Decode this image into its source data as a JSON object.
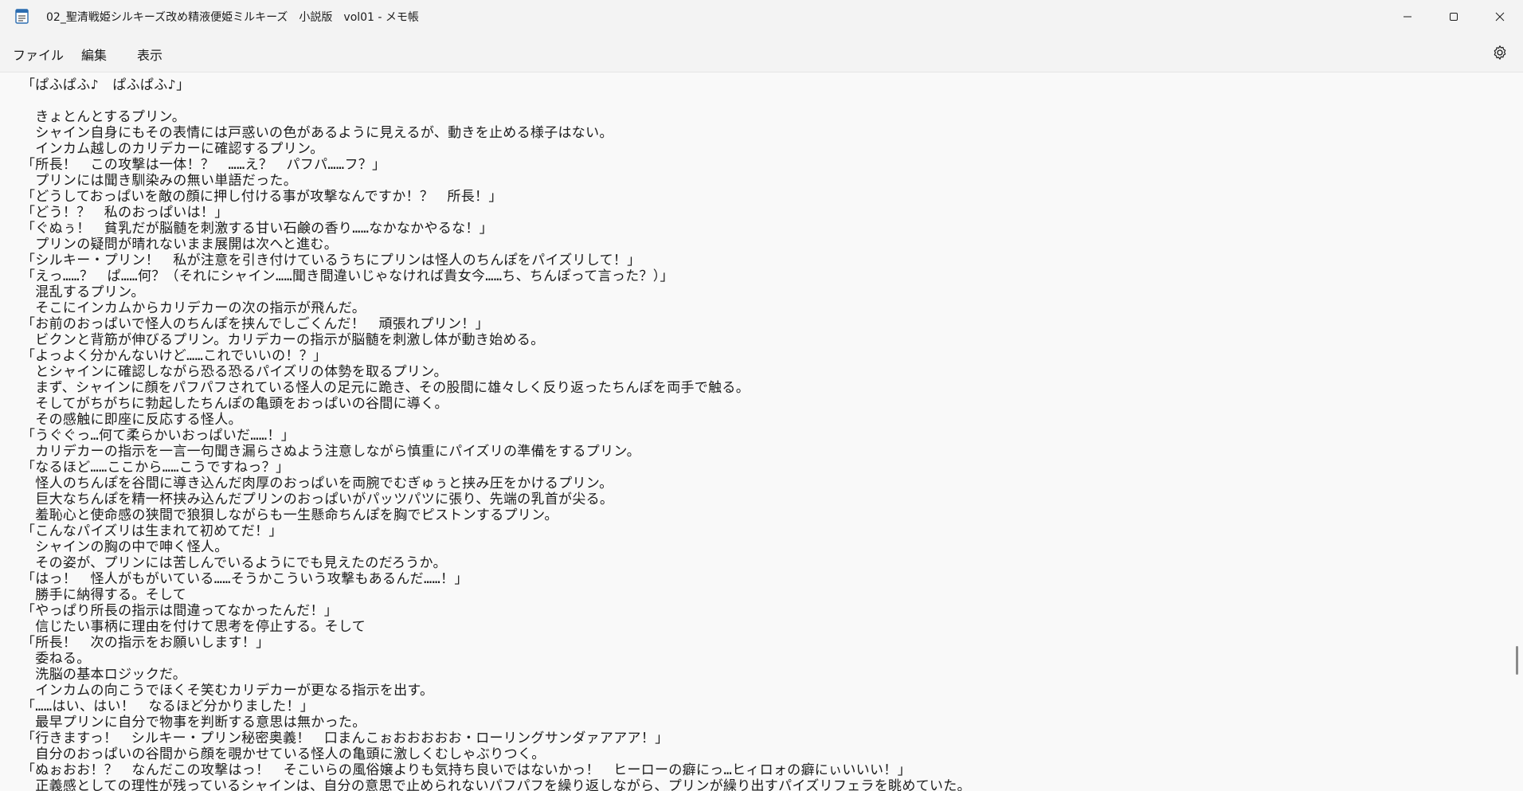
{
  "window": {
    "title": "02_聖清戦姫シルキーズ改め精液便姫ミルキーズ　小説版　vol01 - メモ帳",
    "app_icon": "notepad-icon",
    "controls": [
      "minimize-icon",
      "maximize-icon",
      "close-icon"
    ]
  },
  "menu": {
    "file": "ファイル",
    "edit": "編集",
    "view": "表示",
    "settings_icon": "gear-icon"
  },
  "editor": {
    "lines": [
      "「ぱふぱふ♪　ぱふぱふ♪」",
      "",
      "　きょとんとするプリン。",
      "　シャイン自身にもその表情には戸惑いの色があるように見えるが、動きを止める様子はない。",
      "　インカム越しのカリデカーに確認するプリン。",
      "「所長！　この攻撃は一体！？　……え？　パフパ……フ？」",
      "　プリンには聞き馴染みの無い単語だった。",
      "「どうしておっぱいを敵の顔に押し付ける事が攻撃なんですか！？　所長！」",
      "「どう！？　私のおっぱいは！」",
      "「ぐぬぅ！　貧乳だが脳髄を刺激する甘い石鹸の香り……なかなかやるな！」",
      "　プリンの疑問が晴れないまま展開は次へと進む。",
      "「シルキー・プリン！　私が注意を引き付けているうちにプリンは怪人のちんぽをパイズリして！」",
      "「えっ……？　ぱ……何？（それにシャイン……聞き間違いじゃなければ貴女今……ち、ちんぽって言った？）」",
      "　混乱するプリン。",
      "　そこにインカムからカリデカーの次の指示が飛んだ。",
      "「お前のおっぱいで怪人のちんぽを挟んでしごくんだ！　頑張れプリン！」",
      "　ビクンと背筋が伸びるプリン。カリデカーの指示が脳髄を刺激し体が動き始める。",
      "「よっよく分かんないけど……これでいいの！？」",
      "　とシャインに確認しながら恐る恐るパイズリの体勢を取るプリン。",
      "　まず、シャインに顔をパフパフされている怪人の足元に跪き、その股間に雄々しく反り返ったちんぽを両手で触る。",
      "　そしてがちがちに勃起したちんぽの亀頭をおっぱいの谷間に導く。",
      "　その感触に即座に反応する怪人。",
      "「うぐぐっ…何て柔らかいおっぱいだ……！」",
      "　カリデカーの指示を一言一句聞き漏らさぬよう注意しながら慎重にパイズリの準備をするプリン。",
      "「なるほど……ここから……こうですねっ？」",
      "　怪人のちんぽを谷間に導き込んだ肉厚のおっぱいを両腕でむぎゅぅと挟み圧をかけるプリン。",
      "　巨大なちんぽを精一杯挟み込んだプリンのおっぱいがパッツパツに張り、先端の乳首が尖る。",
      "　羞恥心と使命感の狭間で狼狽しながらも一生懸命ちんぽを胸でピストンするプリン。",
      "「こんなパイズリは生まれて初めてだ！」",
      "　シャインの胸の中で呻く怪人。",
      "　その姿が、プリンには苦しんでいるようにでも見えたのだろうか。",
      "「はっ！　怪人がもがいている……そうかこういう攻撃もあるんだ……！」",
      "　勝手に納得する。そして",
      "「やっぱり所長の指示は間違ってなかったんだ！」",
      "　信じたい事柄に理由を付けて思考を停止する。そして",
      "「所長！　次の指示をお願いします！」",
      "　委ねる。",
      "　洗脳の基本ロジックだ。",
      "　インカムの向こうでほくそ笑むカリデカーが更なる指示を出す。",
      "「……はい、はい！　なるほど分かりました！」",
      "　最早プリンに自分で物事を判断する意思は無かった。",
      "「行きますっ！　シルキー・プリン秘密奥義！　口まんこぉおおおおお・ローリングサンダァアアア！」",
      "　自分のおっぱいの谷間から顔を覗かせている怪人の亀頭に激しくむしゃぶりつく。",
      "「ぬぉおお！？　なんだこの攻撃はっ！　そこいらの風俗嬢よりも気持ち良いではないかっ！　ヒーローの癖にっ…ヒィロォの癖にぃいいい！」",
      "　正義感としての理性が残っているシャインは、自分の意思で止められないパフパフを繰り返しながら、プリンが繰り出すパイズリフェラを眺めていた。"
    ]
  }
}
